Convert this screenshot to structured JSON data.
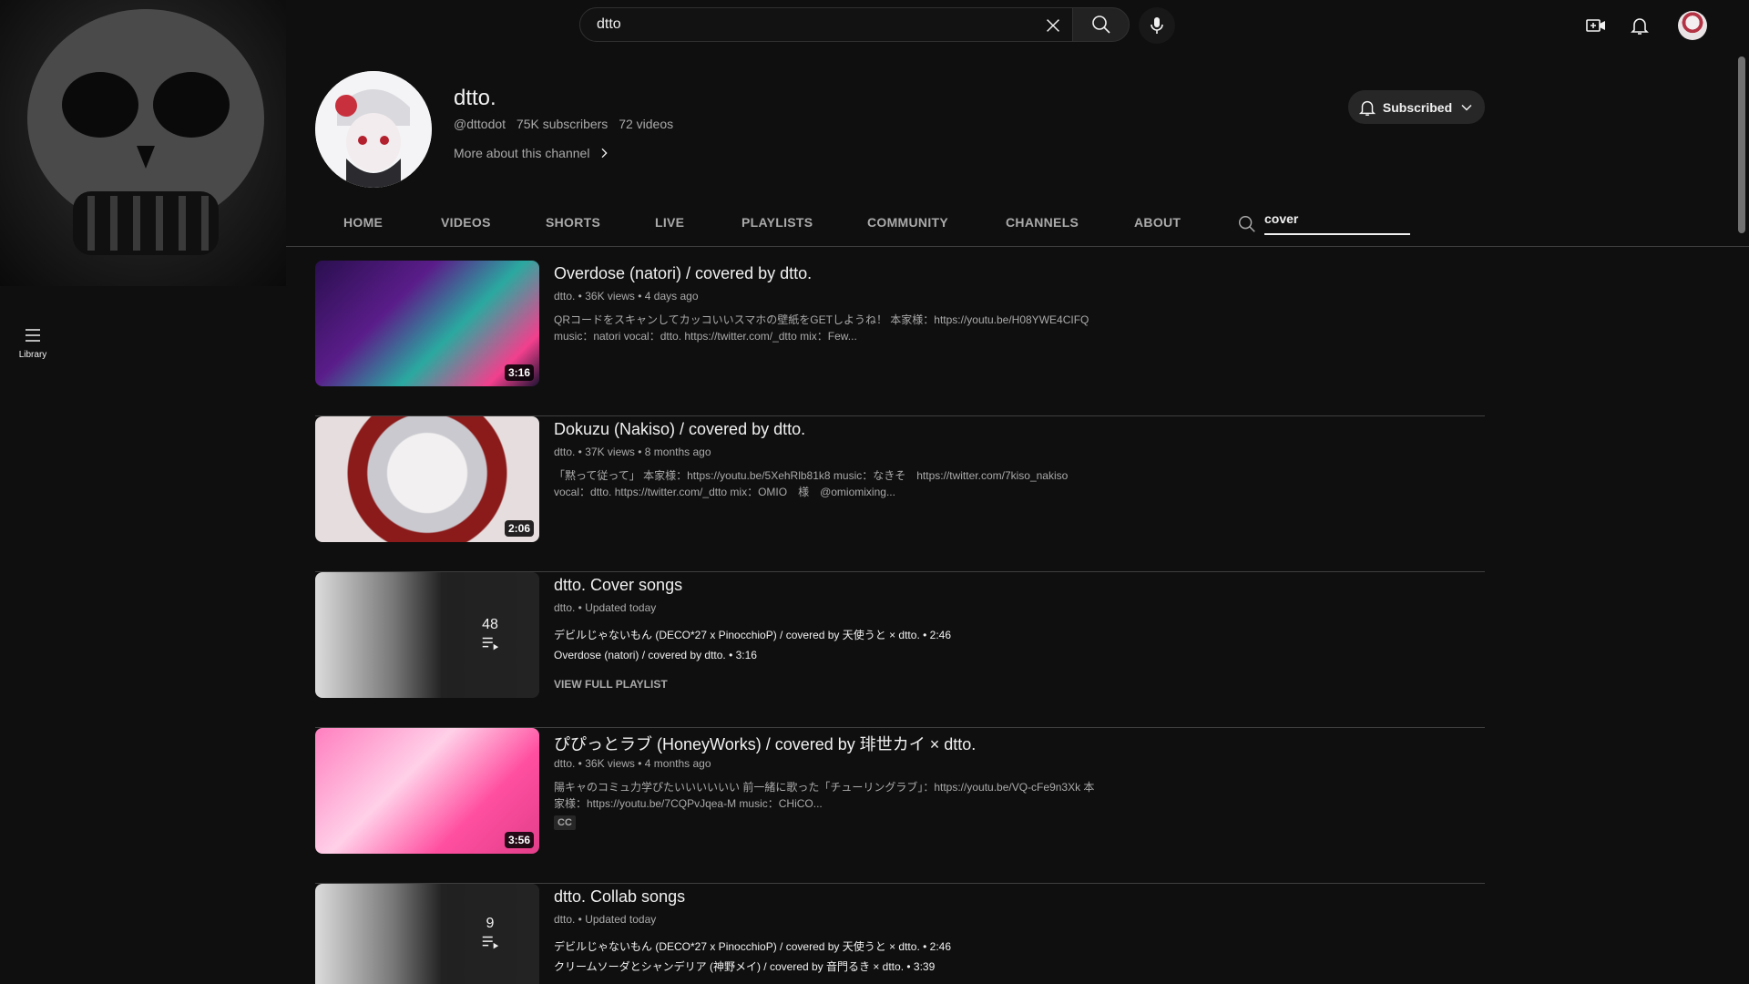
{
  "search": {
    "query": "dtto"
  },
  "guide": {
    "library_label": "Library"
  },
  "channel": {
    "name": "dtto.",
    "handle": "@dttodot",
    "subscribers": "75K subscribers",
    "videos": "72 videos",
    "more_about": "More about this channel",
    "subscribed_label": "Subscribed"
  },
  "tabs": {
    "home": "HOME",
    "videos": "VIDEOS",
    "shorts": "SHORTS",
    "live": "LIVE",
    "playlists": "PLAYLISTS",
    "community": "COMMUNITY",
    "channels": "CHANNELS",
    "about": "ABOUT",
    "search_value": "cover"
  },
  "results": [
    {
      "title": "Overdose (natori) / covered by dtto.",
      "meta": "dtto. • 36K views • 4 days ago",
      "desc1": "QRコードをスキャンしてカッコいいスマホの壁紙をGETしようね！ 本家様：https://youtu.be/H08YWE4CIFQ",
      "desc2": "music：natori vocal：dtto. https://twitter.com/_dtto mix：Few...",
      "duration": "3:16"
    },
    {
      "title": "Dokuzu (Nakiso) / covered by dtto.",
      "meta": "dtto. • 37K views • 8 months ago",
      "desc1": "「黙って従って」 本家様：https://youtu.be/5XehRlb81k8 music：なきそ　https://twitter.com/7kiso_nakiso",
      "desc2": "vocal：dtto. https://twitter.com/_dtto mix：OMIO　様　@omiomixing...",
      "duration": "2:06"
    },
    {
      "title": "dtto. Cover songs",
      "meta": "dtto. • Updated today",
      "item1": "デビルじゃないもん (DECO*27 x PinocchioP) / covered by 天使うと × dtto. • 2:46",
      "item2": "Overdose (natori) / covered by dtto. • 3:16",
      "view_full": "VIEW FULL PLAYLIST",
      "count": "48"
    },
    {
      "title": "ぴぴっとラブ (HoneyWorks) / covered by 琲世カイ × dtto.",
      "meta": "dtto. • 36K views • 4 months ago",
      "desc1": "陽キャのコミュ力学ぴたいいいいいい 前一緒に歌った「チューリングラブ」：https://youtu.be/VQ-cFe9n3Xk 本",
      "desc2": "家様：https://youtu.be/7CQPvJqea-M music：CHiCO...",
      "badge": "CC",
      "duration": "3:56"
    },
    {
      "title": "dtto. Collab songs",
      "meta": "dtto. • Updated today",
      "item1": "デビルじゃないもん (DECO*27 x PinocchioP) / covered by 天使うと × dtto. • 2:46",
      "item2": "クリームソーダとシャンデリア (神野メイ) / covered by 音門るき × dtto. • 3:39",
      "count": "9"
    }
  ]
}
